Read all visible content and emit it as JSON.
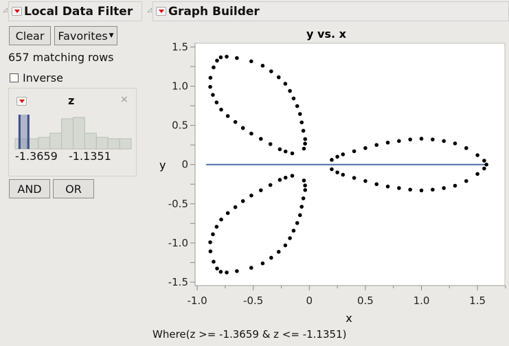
{
  "filter_panel": {
    "title": "Local Data Filter",
    "clear_label": "Clear",
    "favorites_label": "Favorites",
    "matching_rows": "657 matching rows",
    "inverse_label": "Inverse",
    "inverse_checked": false,
    "column": {
      "name": "z",
      "range_min_label": "-1.3659",
      "range_max_label": "-1.1351",
      "histogram_relative_counts": [
        15,
        15,
        17,
        23,
        44,
        46,
        23,
        17,
        15,
        15
      ],
      "selected_bins": [
        1
      ]
    },
    "and_label": "AND",
    "or_label": "OR"
  },
  "graph_builder": {
    "title": "Graph Builder",
    "where_clause": "Where(z >= -1.3659 & z <= -1.1351)"
  },
  "chart_data": {
    "type": "scatter",
    "title": "y vs. x",
    "xlabel": "x",
    "ylabel": "y",
    "xlim": [
      -1.0,
      1.75
    ],
    "ylim": [
      -1.55,
      1.6
    ],
    "xticks": [
      "-1.0",
      "-0.5",
      "0",
      "0.5",
      "1.0",
      "1.5"
    ],
    "yticks": [
      "1.5",
      "1.0",
      "0.5",
      "0",
      "-0.5",
      "-1.0",
      "-1.5"
    ],
    "grid": false,
    "point_color": "#000000",
    "fit_line": {
      "color": "#4a6aa5",
      "x": [
        -0.92,
        1.58
      ],
      "y": [
        0,
        0
      ]
    },
    "points": [
      [
        0.2,
        0.06
      ],
      [
        0.25,
        0.1
      ],
      [
        0.3,
        0.13
      ],
      [
        0.4,
        0.17
      ],
      [
        0.5,
        0.21
      ],
      [
        0.6,
        0.25
      ],
      [
        0.7,
        0.28
      ],
      [
        0.8,
        0.3
      ],
      [
        0.9,
        0.32
      ],
      [
        1.0,
        0.33
      ],
      [
        1.1,
        0.32
      ],
      [
        1.2,
        0.3
      ],
      [
        1.3,
        0.27
      ],
      [
        1.4,
        0.21
      ],
      [
        1.5,
        0.12
      ],
      [
        1.56,
        0.05
      ],
      [
        1.58,
        0
      ],
      [
        0.2,
        -0.06
      ],
      [
        0.25,
        -0.1
      ],
      [
        0.3,
        -0.13
      ],
      [
        0.4,
        -0.17
      ],
      [
        0.5,
        -0.21
      ],
      [
        0.6,
        -0.25
      ],
      [
        0.7,
        -0.28
      ],
      [
        0.8,
        -0.3
      ],
      [
        0.9,
        -0.32
      ],
      [
        1.0,
        -0.33
      ],
      [
        1.1,
        -0.32
      ],
      [
        1.2,
        -0.3
      ],
      [
        1.3,
        -0.27
      ],
      [
        1.4,
        -0.21
      ],
      [
        1.5,
        -0.12
      ],
      [
        1.56,
        -0.05
      ],
      [
        -0.152,
        0.143
      ],
      [
        -0.212,
        0.167
      ],
      [
        -0.263,
        0.195
      ],
      [
        -0.347,
        0.261
      ],
      [
        -0.432,
        0.328
      ],
      [
        -0.517,
        0.395
      ],
      [
        -0.592,
        0.466
      ],
      [
        -0.66,
        0.543
      ],
      [
        -0.727,
        0.619
      ],
      [
        -0.786,
        0.701
      ],
      [
        -0.827,
        0.793
      ],
      [
        -0.86,
        0.889
      ],
      [
        -0.884,
        0.991
      ],
      [
        -0.882,
        1.107
      ],
      [
        -0.854,
        1.239
      ],
      [
        -0.823,
        1.326
      ],
      [
        -0.79,
        1.368
      ],
      [
        -0.048,
        0.203
      ],
      [
        -0.038,
        0.267
      ],
      [
        -0.037,
        0.325
      ],
      [
        -0.053,
        0.431
      ],
      [
        -0.068,
        0.538
      ],
      [
        -0.083,
        0.645
      ],
      [
        -0.108,
        0.746
      ],
      [
        -0.14,
        0.843
      ],
      [
        -0.173,
        0.939
      ],
      [
        -0.214,
        1.031
      ],
      [
        -0.273,
        1.113
      ],
      [
        -0.34,
        1.189
      ],
      [
        -0.416,
        1.261
      ],
      [
        -0.518,
        1.317
      ],
      [
        -0.646,
        1.359
      ],
      [
        -0.737,
        1.376
      ],
      [
        -0.152,
        -0.143
      ],
      [
        -0.212,
        -0.167
      ],
      [
        -0.263,
        -0.195
      ],
      [
        -0.347,
        -0.261
      ],
      [
        -0.432,
        -0.328
      ],
      [
        -0.517,
        -0.395
      ],
      [
        -0.592,
        -0.466
      ],
      [
        -0.66,
        -0.543
      ],
      [
        -0.727,
        -0.619
      ],
      [
        -0.786,
        -0.701
      ],
      [
        -0.827,
        -0.793
      ],
      [
        -0.86,
        -0.889
      ],
      [
        -0.884,
        -0.991
      ],
      [
        -0.882,
        -1.107
      ],
      [
        -0.854,
        -1.239
      ],
      [
        -0.823,
        -1.326
      ],
      [
        -0.79,
        -1.368
      ],
      [
        -0.048,
        -0.203
      ],
      [
        -0.038,
        -0.267
      ],
      [
        -0.037,
        -0.325
      ],
      [
        -0.053,
        -0.431
      ],
      [
        -0.068,
        -0.538
      ],
      [
        -0.083,
        -0.645
      ],
      [
        -0.108,
        -0.746
      ],
      [
        -0.14,
        -0.843
      ],
      [
        -0.173,
        -0.939
      ],
      [
        -0.214,
        -1.031
      ],
      [
        -0.273,
        -1.113
      ],
      [
        -0.34,
        -1.189
      ],
      [
        -0.416,
        -1.261
      ],
      [
        -0.518,
        -1.317
      ],
      [
        -0.646,
        -1.359
      ],
      [
        -0.737,
        -1.376
      ]
    ]
  }
}
